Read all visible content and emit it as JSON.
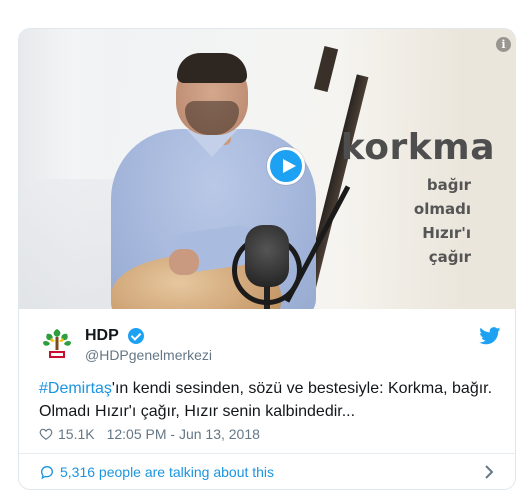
{
  "video": {
    "overlay_title": "korkma",
    "overlay_lines": [
      "bağır",
      "olmadı",
      "Hızır'ı",
      "çağır"
    ],
    "info_label": "i"
  },
  "tweet": {
    "author_name": "HDP",
    "author_handle": "@HDPgenelmerkezi",
    "hashtag": "#Demirtaş",
    "text_rest": "'ın kendi sesinden, sözü ve bestesiyle: Korkma, bağır. Olmadı Hızır'ı çağır, Hızır senin kalbindedir...",
    "likes": "15.1K",
    "timestamp": "12:05 PM - Jun 13, 2018"
  },
  "footer": {
    "talking_text": "5,316 people are talking about this"
  },
  "colors": {
    "accent": "#1da1f2",
    "link": "#1b95e0",
    "muted": "#657786",
    "text": "#14171a",
    "border": "#e1e8ed"
  },
  "icons": [
    "play-icon",
    "info-icon",
    "verified-icon",
    "twitter-bird-icon",
    "heart-icon",
    "speech-bubble-icon",
    "chevron-right-icon",
    "hdp-logo"
  ]
}
